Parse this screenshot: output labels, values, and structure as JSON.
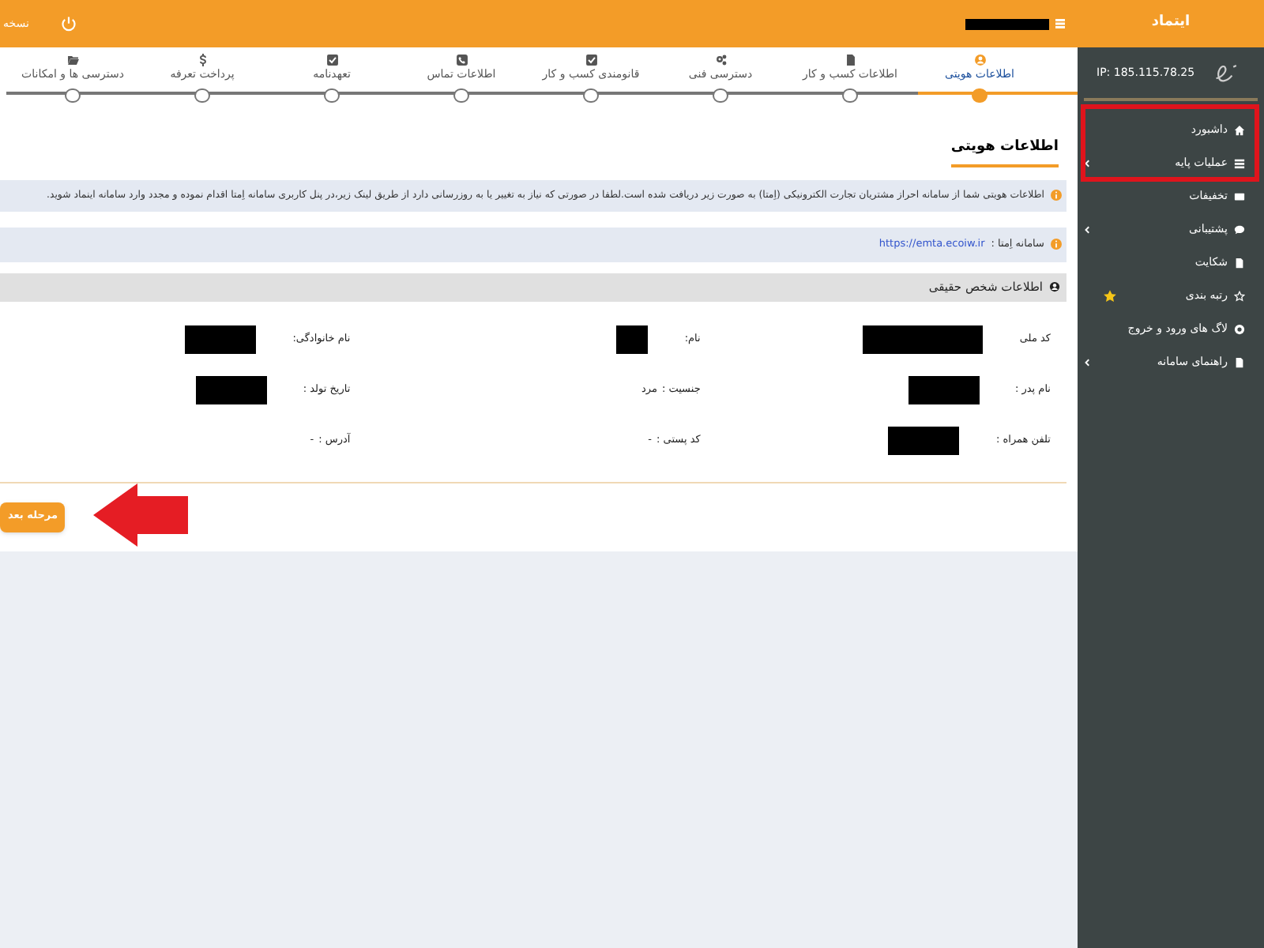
{
  "topbar": {
    "brand": "ایتماد",
    "version_label": "نسخه"
  },
  "sidebar": {
    "ip": "IP: 185.115.78.25",
    "items": [
      {
        "label": "داشبورد",
        "expandable": false,
        "starred": false
      },
      {
        "label": "عملیات پایه",
        "expandable": true,
        "starred": false
      },
      {
        "label": "تخفیفات",
        "expandable": false,
        "starred": false
      },
      {
        "label": "پشتیبانی",
        "expandable": true,
        "starred": false
      },
      {
        "label": "شکایت",
        "expandable": false,
        "starred": false
      },
      {
        "label": "رتبه بندی",
        "expandable": false,
        "starred": true
      },
      {
        "label": "لاگ های ورود و خروج",
        "expandable": false,
        "starred": false
      },
      {
        "label": "راهنمای سامانه",
        "expandable": true,
        "starred": false
      }
    ]
  },
  "steps": [
    {
      "label": "اطلاعات هویتی",
      "selected": true
    },
    {
      "label": "اطلاعات کسب و کار",
      "selected": false
    },
    {
      "label": "دسترسی فنی",
      "selected": false
    },
    {
      "label": "قانومندی کسب و کار",
      "selected": false
    },
    {
      "label": "اطلاعات تماس",
      "selected": false
    },
    {
      "label": "تعهدنامه",
      "selected": false
    },
    {
      "label": "پرداخت تعرفه",
      "selected": false
    },
    {
      "label": "دسترسی ها و امکانات",
      "selected": false
    }
  ],
  "section_title": "اطلاعات هویتی",
  "notice": "اطلاعات هویتی شما از سامانه احراز مشتریان تجارت الکترونیکی (اِمتا) به صورت زیر دریافت شده است.لطفا در صورتی که نیاز به تغییر یا به روزرسانی دارد از طریق لینک زیر،در پنل کاربری سامانه اِمتا اقدام نموده و مجدد وارد سامانه اینماد شوید.",
  "emta": {
    "label": "سامانه اِمتا :",
    "link": "https://emta.ecoiw.ir"
  },
  "panel": {
    "title": "اطلاعات شخص حقیقی",
    "fields": [
      {
        "label": "کد ملی",
        "redacted": true
      },
      {
        "label": "نام:",
        "redacted": true
      },
      {
        "label": "نام خانوادگی:",
        "redacted": true
      },
      {
        "label": "نام پدر :",
        "redacted": true
      },
      {
        "label": "جنسیت :",
        "value": "مرد",
        "redacted": false
      },
      {
        "label": "تاریخ تولد :",
        "redacted": true
      },
      {
        "label": "تلفن همراه :",
        "redacted": true
      },
      {
        "label": "کد پستی :",
        "value": "-",
        "redacted": false
      },
      {
        "label": "آدرس :",
        "value": "-",
        "redacted": false
      }
    ]
  },
  "next_button": "مرحله بعد"
}
